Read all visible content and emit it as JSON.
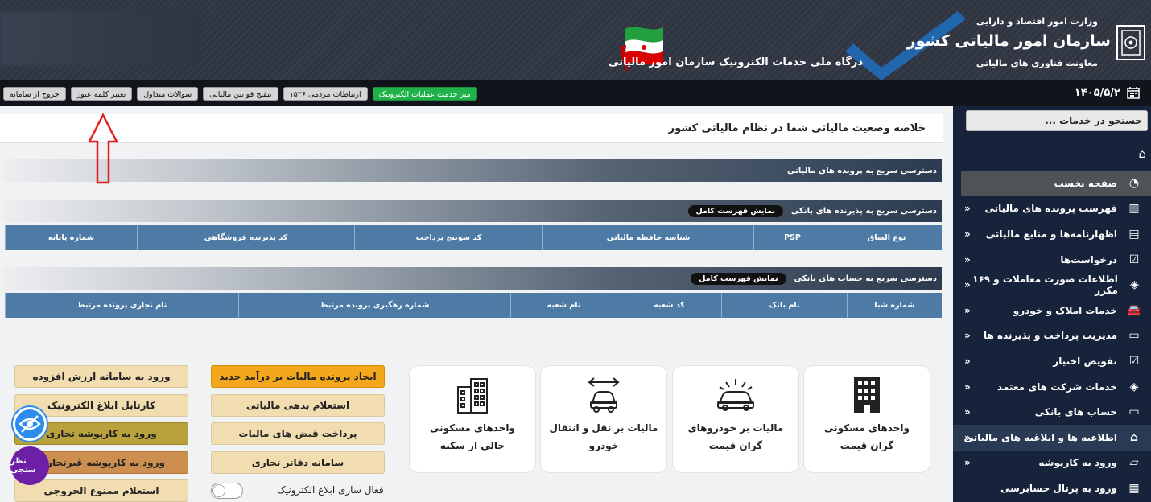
{
  "header": {
    "ministry": "وزارت امور اقتصاد و دارایی",
    "org_name": "سازمان امور مالیاتی کشور",
    "deputy": "معاونت فناوری های مالیاتی",
    "portal_title": "درگاه ملی خدمات الکترونیک سازمان امور مالیاتی"
  },
  "toolbar": {
    "date": "۱۴۰۵/۵/۲",
    "buttons": {
      "logout": "خروج از سامانه",
      "change_password": "تغییر کلمه عبور",
      "faq": "سوالات متداول",
      "tax_laws": "تنقیح قوانین مالیاتی",
      "public_relations": "ارتباطات مردمی ۱۵۲۶",
      "e_services_desk": "میز خدمت عملیات الکترونیک"
    }
  },
  "sidebar": {
    "search_placeholder": "جستجو در خدمات ...",
    "items": [
      {
        "label": "صفحه نخست"
      },
      {
        "label": "فهرست پرونده های مالیاتی"
      },
      {
        "label": "اظهارنامه‌ها و منابع مالیاتی"
      },
      {
        "label": "درخواست‌ها"
      },
      {
        "label": "اطلاعات صورت معاملات و ۱۶۹ مکرر"
      },
      {
        "label": "خدمات املاک و خودرو"
      },
      {
        "label": "مدیریت پرداخت و پذیرنده ها"
      },
      {
        "label": "تفویض اختیار"
      },
      {
        "label": "خدمات شرکت های معتمد"
      },
      {
        "label": "حساب های بانکی"
      },
      {
        "label": "اطلاعیه ها و ابلاغیه های مالیاتی"
      },
      {
        "label": "ورود به کارپوشه"
      },
      {
        "label": "ورود به پرتال حسابرسی"
      }
    ]
  },
  "main": {
    "page_title": "خلاصه وضعیت مالیاتی شما در نظام مالیاتی کشور",
    "section_tax_files": "دسترسی سریع به پرونده های مالیاتی",
    "section_bank_acceptors": "دسترسی سریع به پذیرنده های بانکی",
    "section_bank_accounts": "دسترسی سریع به حساب های بانکی",
    "show_full_list": "نمایش فهرست کامل",
    "acceptor_columns": [
      "نوع الصاق",
      "PSP",
      "شناسه حافظه مالیاتی",
      "کد سوییچ پرداخت",
      "کد پذیرنده فروشگاهی",
      "شماره پایانه"
    ],
    "account_columns": [
      "شماره شبا",
      "نام بانک",
      "کد شعبه",
      "نام شعبه",
      "شماره رهگیری پرونده مرتبط",
      "نام تجاری پرونده مرتبط"
    ],
    "cards": {
      "expensive_housing_1": "واحدهای مسکونی",
      "expensive_housing_2": "گران قیمت",
      "luxury_cars_1": "مالیات بر خودروهای",
      "luxury_cars_2": "گران قیمت",
      "transfer_1": "مالیات بر نقل و انتقال",
      "transfer_2": "خودرو",
      "vacant_housing_1": "واحدهای مسکونی",
      "vacant_housing_2": "خالی از سکنه"
    },
    "actions": {
      "new_income_tax_file": "ایجاد پرونده مالیات بر درآمد جدید",
      "tax_debt_inquiry": "استعلام بدهی مالیاتی",
      "pay_tax_bills": "پرداخت قبض های مالیات",
      "commercial_books": "سامانه دفاتر تجاری",
      "enable_e_notice": "فعال سازی ابلاغ الکترونیک",
      "vat_system": "ورود به سامانه ارزش افزوده",
      "e_notice_cartable": "کارتابل ابلاغ الکترونیک",
      "commercial_workfolder": "ورود به کارپوشه تجاری",
      "non_commercial_workfolder": "ورود به کارپوشه غیرتجاری",
      "exit_ban_inquiry": "استعلام ممنوع الخروجی"
    },
    "survey": "نظر سنجی"
  }
}
